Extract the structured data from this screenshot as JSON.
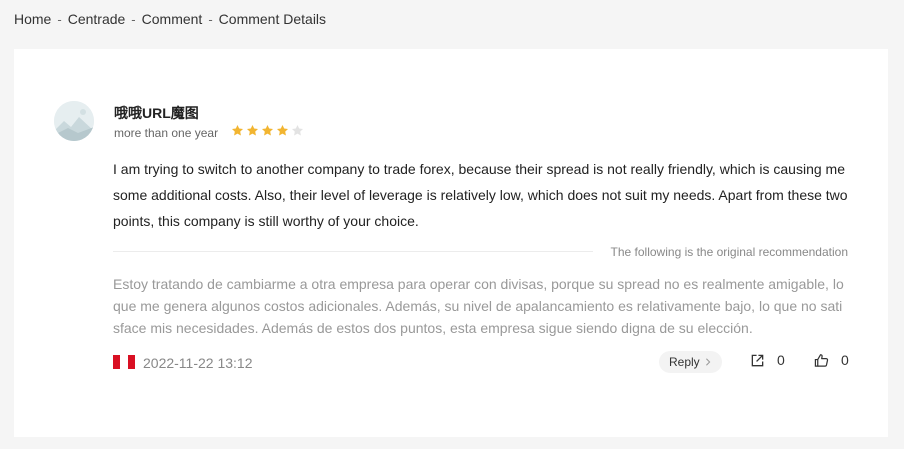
{
  "breadcrumb": {
    "items": [
      "Home",
      "Centrade",
      "Comment",
      "Comment Details"
    ],
    "separator": "-"
  },
  "comment": {
    "username": "哦哦URL魔图",
    "time": "more than one year",
    "rating": 4,
    "rating_max": 5,
    "content": "I am trying to switch to another company to trade forex, because their spread is not really friendly, which is causing me some additional costs. Also, their level of leverage is relatively low, which does not suit my needs. Apart from these two points, this company is still worthy of your choice.",
    "original_label": "The following is the original recommendation",
    "original": "Estoy tratando de cambiarme a otra empresa para operar con divisas, porque su spread no es realmente amigable, lo que me genera algunos costos adicionales. Además, su nivel de apalancamiento es relativamente bajo, lo que no satisface mis necesidades. Además de estos dos puntos, esta empresa sigue siendo digna de su elección.",
    "date": "2022-11-22 13:12",
    "reply_label": "Reply",
    "share_count": "0",
    "like_count": "0"
  },
  "icons": {
    "flag": "peru-flag-icon",
    "reply": "chevron-right-icon",
    "share": "share-icon",
    "like": "thumbs-up-icon"
  },
  "colors": {
    "star_filled": "#f2b531",
    "star_empty": "#e3e3e3",
    "flag_red": "#d91023"
  }
}
